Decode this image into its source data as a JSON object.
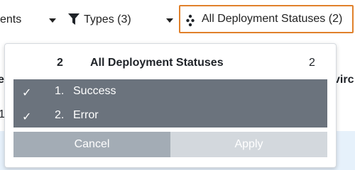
{
  "filters": {
    "events_label_partial": "ents",
    "types_label": "Types (3)",
    "status_label": "All Deployment Statuses (2)"
  },
  "background_table": {
    "left_header_fragment": "e",
    "left_row_fragment": "1",
    "right_header_fragment": "virc"
  },
  "dropdown": {
    "header": {
      "selected_count": "2",
      "title": "All Deployment Statuses",
      "total_count": "2"
    },
    "options": [
      {
        "check": "✓",
        "number": "1.",
        "label": "Success"
      },
      {
        "check": "✓",
        "number": "2.",
        "label": "Error"
      }
    ],
    "cancel_label": "Cancel",
    "apply_label": "Apply"
  },
  "colors": {
    "highlight_border": "#e0812b",
    "option_bg": "#6b737d",
    "cancel_bg": "#a3acb5",
    "apply_bg": "#d3d8dd",
    "table_row_bg": "#e6f1fb"
  }
}
